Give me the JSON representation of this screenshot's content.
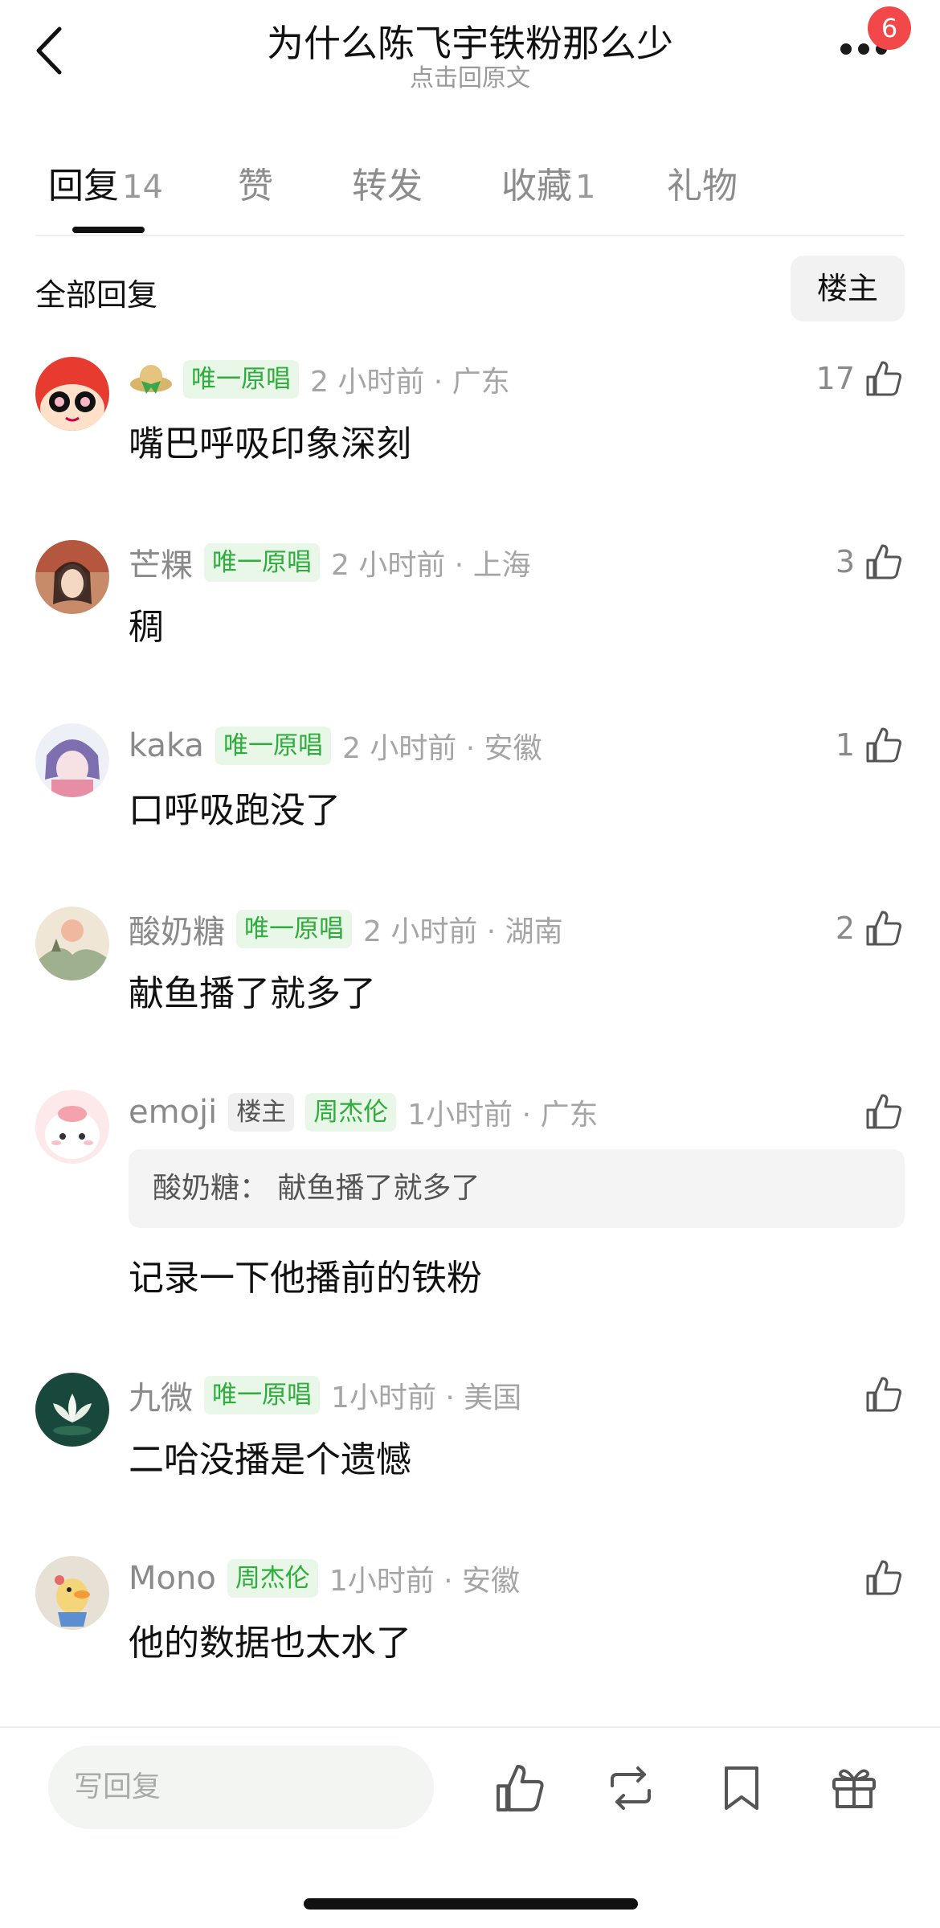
{
  "header": {
    "title": "为什么陈飞宇铁粉那么少",
    "subtitle": "点击回原文",
    "badge": "6",
    "icons": [
      "back-icon",
      "more-icon"
    ]
  },
  "tabs": [
    {
      "label": "回复",
      "count": "14",
      "active": true
    },
    {
      "label": "赞",
      "count": ""
    },
    {
      "label": "转发",
      "count": ""
    },
    {
      "label": "收藏",
      "count": "1"
    },
    {
      "label": "礼物",
      "count": ""
    }
  ],
  "section": {
    "title": "全部回复",
    "filter_label": "楼主"
  },
  "comments": [
    {
      "username": "",
      "tags": [
        "唯一原唱"
      ],
      "time": "2 小时前 · 广东",
      "text": "嘴巴呼吸印象深刻",
      "likes": "17"
    },
    {
      "username": "芒粿",
      "tags": [
        "唯一原唱"
      ],
      "time": "2 小时前 · 上海",
      "text": "稠",
      "likes": "3"
    },
    {
      "username": "kaka",
      "tags": [
        "唯一原唱"
      ],
      "time": "2 小时前 · 安徽",
      "text": "口呼吸跑没了",
      "likes": "1"
    },
    {
      "username": "酸奶糖",
      "tags": [
        "唯一原唱"
      ],
      "time": "2 小时前 · 湖南",
      "text": "献鱼播了就多了",
      "likes": "2"
    },
    {
      "username": "emoji",
      "op_tag": "楼主",
      "tags": [
        "周杰伦"
      ],
      "time": "1小时前 · 广东",
      "quote": "酸奶糖：  献鱼播了就多了",
      "text": "记录一下他播前的铁粉",
      "likes": ""
    },
    {
      "username": "九微",
      "tags": [
        "唯一原唱"
      ],
      "time": "1小时前 · 美国",
      "text": "二哈没播是个遗憾",
      "likes": ""
    },
    {
      "username": "Mono",
      "tags": [
        "周杰伦"
      ],
      "time": "1小时前 · 安徽",
      "text": "他的数据也太水了",
      "likes": ""
    }
  ],
  "bottom_bar": {
    "reply_placeholder": "写回复",
    "icons": [
      "like-icon",
      "repost-icon",
      "bookmark-icon",
      "gift-icon"
    ]
  },
  "colors": {
    "tag_green": "#2fad3c",
    "tag_green_bg": "#e8f7e8",
    "badge_red": "#f2484a"
  }
}
